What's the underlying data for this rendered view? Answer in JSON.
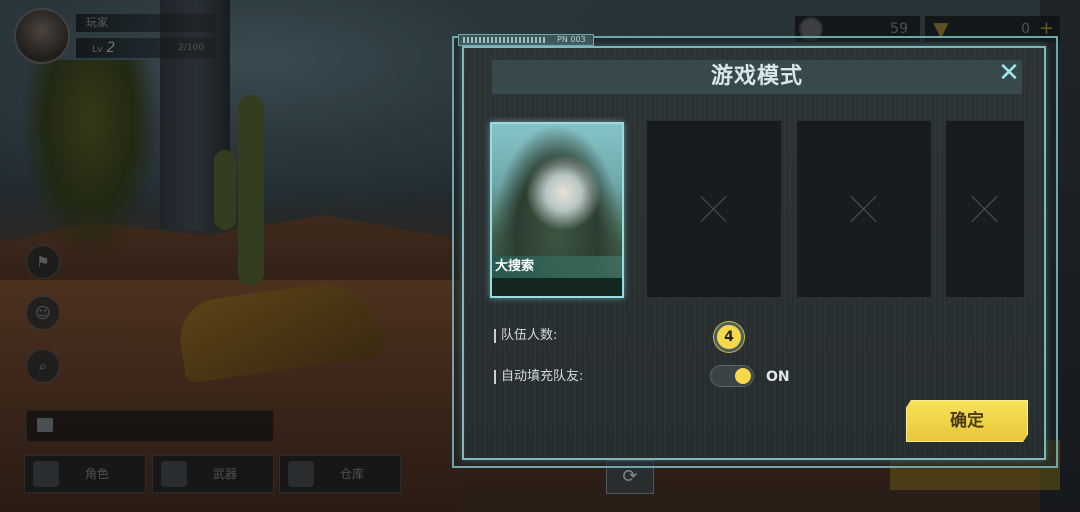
{
  "player": {
    "name": "玩家",
    "level_prefix": "Lv",
    "level": "2",
    "xp": "2/100"
  },
  "currency": [
    {
      "icon": "coin-icon",
      "value": "59"
    },
    {
      "icon": "triangle-token-icon",
      "value": "0",
      "plus": "+"
    }
  ],
  "bottom_tabs": [
    {
      "label": "角色",
      "icon": "character-icon"
    },
    {
      "label": "武器",
      "icon": "weapon-icon"
    },
    {
      "label": "仓库",
      "icon": "warehouse-icon"
    }
  ],
  "modal": {
    "tag": "PN 003",
    "title": "游戏模式",
    "close": "✕",
    "modes": [
      {
        "label": "大搜索",
        "selected": true
      },
      {
        "label": "",
        "locked": true
      },
      {
        "label": "",
        "locked": true
      },
      {
        "label": "",
        "locked": true
      }
    ],
    "team_size_label": "队伍人数:",
    "team_size": "4",
    "autofill_label": "自动填充队友:",
    "autofill_state": "ON",
    "confirm": "确定"
  },
  "colors": {
    "accent": "#7fb8bc",
    "highlight": "#f5d94b"
  }
}
